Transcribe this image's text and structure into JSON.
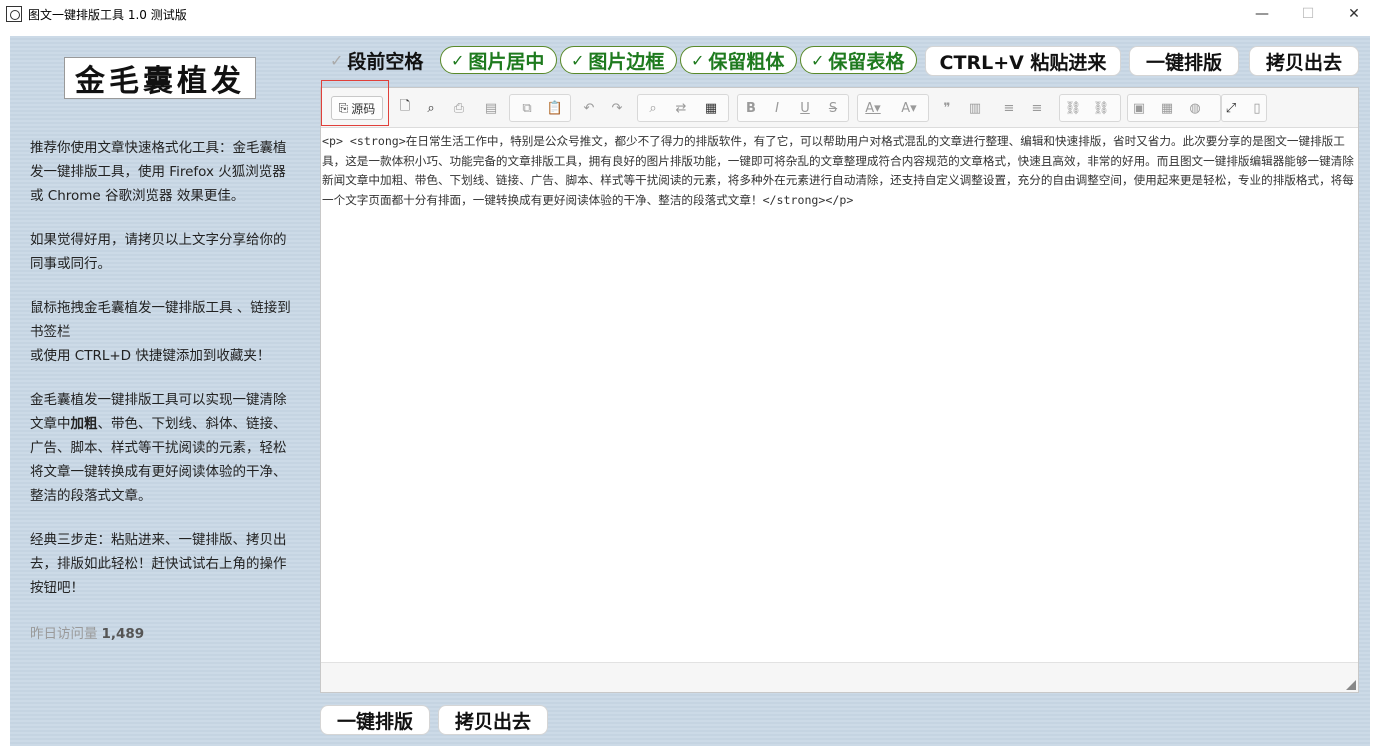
{
  "window": {
    "title": "图文一键排版工具 1.0 测试版",
    "minimize": "—",
    "maximize": "☐",
    "close": "✕"
  },
  "sidebar": {
    "logo_text": "金毛囊植发",
    "p1": "推荐你使用文章快速格式化工具：金毛囊植发一键排版工具，使用 Firefox 火狐浏览器 或 Chrome 谷歌浏览器 效果更佳。",
    "p2": "如果觉得好用，请拷贝以上文字分享给你的同事或同行。",
    "p3a": "鼠标拖拽金毛囊植发一键排版工具 、链接到书签栏",
    "p3b": "或使用 CTRL+D 快捷键添加到收藏夹！",
    "p4a": "金毛囊植发一键排版工具可以实现一键清除文章中",
    "p4b": "加粗",
    "p4c": "、带色、下划线、斜体、链接、广告、脚本、样式等干扰阅读的元素，轻松将文章一键转换成有更好阅读体验的干净、整洁的段落式文章。",
    "p5": "经典三步走：粘贴进来、一键排版、拷贝出去，排版如此轻松！赶快试试右上角的操作按钮吧！",
    "visits_label": "昨日访问量",
    "visits_value": "1,489"
  },
  "options": [
    {
      "label": "段前空格",
      "checked": false
    },
    {
      "label": "图片居中",
      "checked": true
    },
    {
      "label": "图片边框",
      "checked": true
    },
    {
      "label": "保留粗体",
      "checked": true
    },
    {
      "label": "保留表格",
      "checked": true
    }
  ],
  "check_glyph": "✓",
  "actions": {
    "paste": "CTRL+V 粘贴进来",
    "format": "一键排版",
    "copy": "拷贝出去"
  },
  "toolbar": {
    "source_label": "源码",
    "source_icon": "source-code-icon"
  },
  "editor": {
    "content": "<p>    <strong>在日常生活工作中，特别是公众号推文，都少不了得力的排版软件，有了它，可以帮助用户对格式混乱的文章进行整理、编辑和快速排版，省时又省力。此次要分享的是图文一键排版工具，这是一款体积小巧、功能完备的文章排版工具，拥有良好的图片排版功能，一键即可将杂乱的文章整理成符合内容规范的文章格式，快速且高效，非常的好用。而且图文一键排版编辑器能够一键清除新闻文章中加粗、带色、下划线、链接、广告、脚本、样式等干扰阅读的元素，将多种外在元素进行自动清除，还支持自定义调整设置，充分的自由调整空间，使用起来更是轻松，专业的排版格式，将每一个文字页面都十分有排面，一键转换成有更好阅读体验的干净、整洁的段落式文章！</strong></p>"
  },
  "bottom": {
    "format": "一键排版",
    "copy": "拷贝出去"
  }
}
